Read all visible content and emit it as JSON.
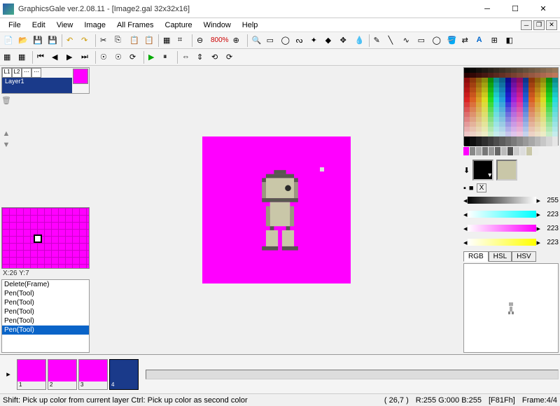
{
  "title": "GraphicsGale ver.2.08.11 - [Image2.gal 32x32x16]",
  "menu": [
    "File",
    "Edit",
    "View",
    "Image",
    "All Frames",
    "Capture",
    "Window",
    "Help"
  ],
  "zoom": "800%",
  "layer_label": "Layer1",
  "coord": "X:26 Y:7",
  "history": [
    "Delete(Frame)",
    "Pen(Tool)",
    "Pen(Tool)",
    "Pen(Tool)",
    "Pen(Tool)",
    "Pen(Tool)"
  ],
  "history_sel": 5,
  "sliders": [
    {
      "g": "gray",
      "val": 255
    },
    {
      "g": "cyan",
      "val": 223
    },
    {
      "g": "magenta",
      "val": 223
    },
    {
      "g": "yellow",
      "val": 223
    }
  ],
  "color_tabs": [
    "RGB",
    "HSL",
    "HSV"
  ],
  "color_tab_active": 0,
  "frames": [
    "1",
    "2",
    "3",
    "4"
  ],
  "frame_sel": 3,
  "status_hint": "Shift: Pick up color from current layer  Ctrl: Pick up color as second color",
  "status_pos": "( 26,7 )",
  "status_rgb": "R:255 G:000 B:255",
  "status_hex": "[F81Fh]",
  "status_frame": "Frame:4/4",
  "fg_color": "#000000",
  "bg_color": "#c9c7a8",
  "x_label": "X"
}
